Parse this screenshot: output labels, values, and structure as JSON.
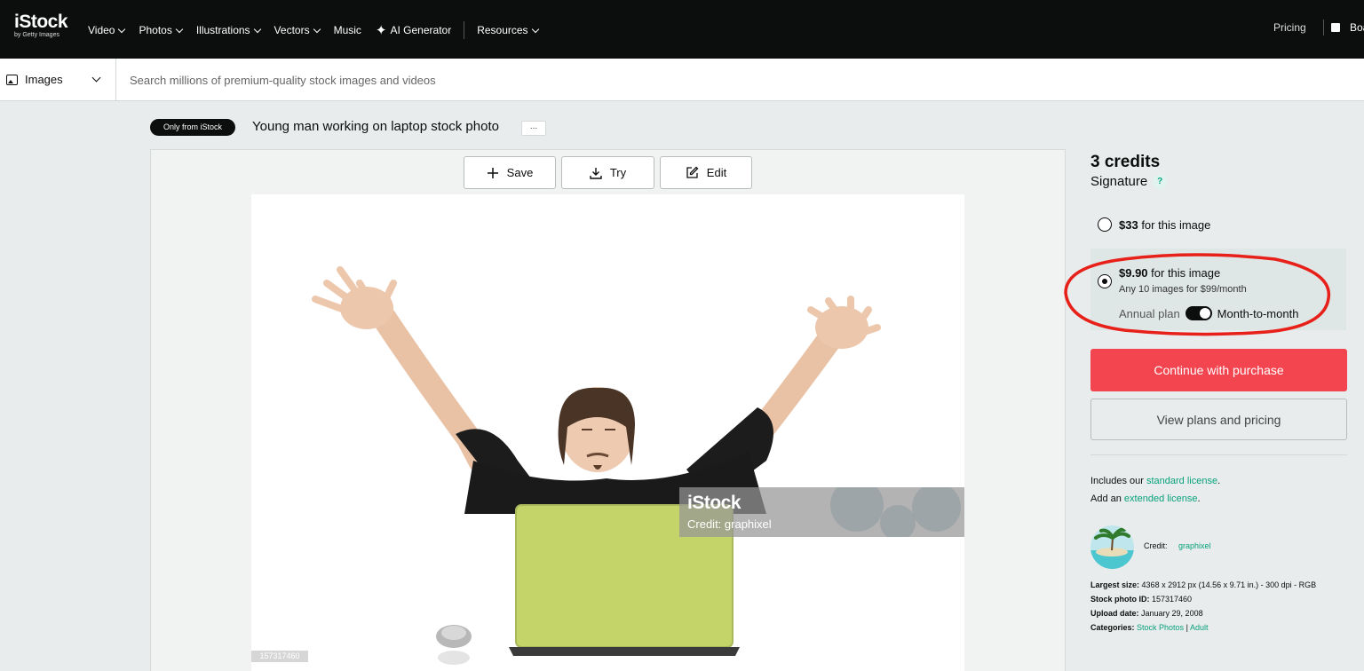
{
  "nav": {
    "logo": "iStock",
    "logo_sub": "by Getty Images",
    "items": [
      {
        "label": "Video",
        "dropdown": true
      },
      {
        "label": "Photos",
        "dropdown": true
      },
      {
        "label": "Illustrations",
        "dropdown": true
      },
      {
        "label": "Vectors",
        "dropdown": true
      },
      {
        "label": "Music",
        "dropdown": false
      },
      {
        "label": "AI Generator",
        "dropdown": false,
        "icon": "sparkle-icon"
      },
      {
        "label": "Resources",
        "dropdown": true
      }
    ],
    "pricing": "Pricing",
    "boards": "Boa"
  },
  "search": {
    "media_type": "Images",
    "placeholder": "Search millions of premium-quality stock images and videos"
  },
  "asset": {
    "badge": "Only from iStock",
    "title": "Young man working on laptop stock photo",
    "more": "...",
    "actions": {
      "save": "Save",
      "try": "Try",
      "edit": "Edit"
    },
    "watermark_logo": "iStock",
    "watermark_credit": "Credit: graphixel",
    "photo_id_overlay": "157317460"
  },
  "purchase": {
    "credits": "3 credits",
    "tier": "Signature",
    "help": "?",
    "option1": {
      "price": "$33",
      "text": " for this image",
      "selected": false
    },
    "option2": {
      "price": "$9.90",
      "text": " for this image",
      "sub": "Any 10 images for $99/month",
      "plan_annual": "Annual plan",
      "plan_monthly": "Month-to-month",
      "selected": true
    },
    "continue_button": "Continue with purchase",
    "plans_button": "View plans and pricing",
    "highlight_color": "#e8201a",
    "accent": "#f24550"
  },
  "license": {
    "line1_prefix": "Includes our ",
    "line1_link": "standard license",
    "line1_suffix": ".",
    "line2_prefix": "Add an ",
    "line2_link": "extended license",
    "line2_suffix": "."
  },
  "contributor": {
    "label": "Credit:",
    "name": "graphixel"
  },
  "details": {
    "size_label": "Largest size:",
    "size_value": "4368 x 2912 px (14.56 x 9.71 in.) - 300 dpi - RGB",
    "id_label": "Stock photo ID:",
    "id_value": "157317460",
    "date_label": "Upload date:",
    "date_value": "January 29, 2008",
    "cat_label": "Categories:",
    "cat1": "Stock Photos",
    "cat_sep": "|",
    "cat2": "Adult"
  }
}
